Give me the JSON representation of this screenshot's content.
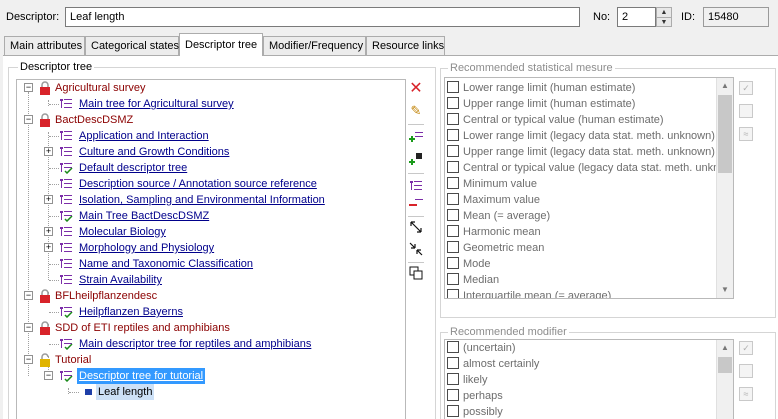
{
  "header": {
    "descriptor_label": "Descriptor:",
    "descriptor_value": "Leaf length",
    "no_label": "No:",
    "no_value": "2",
    "id_label": "ID:",
    "id_value": "15480"
  },
  "tabs": [
    {
      "label": "Main attributes"
    },
    {
      "label": "Categorical states"
    },
    {
      "label": "Descriptor tree"
    },
    {
      "label": "Modifier/Frequency"
    },
    {
      "label": "Resource links"
    }
  ],
  "tree_group": {
    "label": "Descriptor tree"
  },
  "tree": {
    "n0": "Agricultural survey",
    "n1": "Main tree for Agricultural survey",
    "n2": "BactDescDSMZ",
    "n3": "Application and Interaction",
    "n4": "Culture and Growth Conditions",
    "n5": "Default descriptor tree",
    "n6": "Description source / Annotation source reference",
    "n7": "Isolation, Sampling and Environmental Information",
    "n8": "Main Tree BactDescDSMZ",
    "n9": "Molecular Biology",
    "n10": "Morphology and Physiology",
    "n11": "Name and Taxonomic Classification",
    "n12": "Strain Availability",
    "n13": "BFLheilpflanzendesc",
    "n14": "Heilpflanzen Bayerns",
    "n15": "SDD of ETI reptiles and amphibians",
    "n16": "Main descriptor tree for reptiles and amphibians",
    "n17": "Tutorial",
    "n18": "Descriptor tree for tutorial",
    "n19": "Leaf length"
  },
  "toolbar": {
    "icons": [
      "delete-icon",
      "edit-icon",
      "add-child-icon",
      "add-descriptor-icon",
      "tree-settings-icon",
      "remove-icon",
      "expand-all-icon",
      "collapse-all-icon",
      "copy-tree-icon"
    ]
  },
  "stat_group": {
    "label": "Recommended statistical mesure",
    "items": [
      "Lower range limit (human estimate)",
      "Upper range limit (human estimate)",
      "Central or typical value (human estimate)",
      "Lower range limit (legacy data stat. meth. unknown)",
      "Upper range limit (legacy data stat. meth. unknown)",
      "Central or typical value (legacy data stat. meth. unknow",
      "Minimum value",
      "Maximum value",
      "Mean (= average)",
      "Harmonic mean",
      "Geometric mean",
      "Mode",
      "Median",
      "Interquartile mean (= average)"
    ]
  },
  "modifier_group": {
    "label": "Recommended modifier",
    "items": [
      "(uncertain)",
      "almost certainly",
      "likely",
      "perhaps",
      "possibly"
    ]
  },
  "colors": {
    "root_text": "#8b0000",
    "child_link": "#00008b",
    "selection": "#3399ff",
    "disabled_text": "#6d6d6d"
  }
}
